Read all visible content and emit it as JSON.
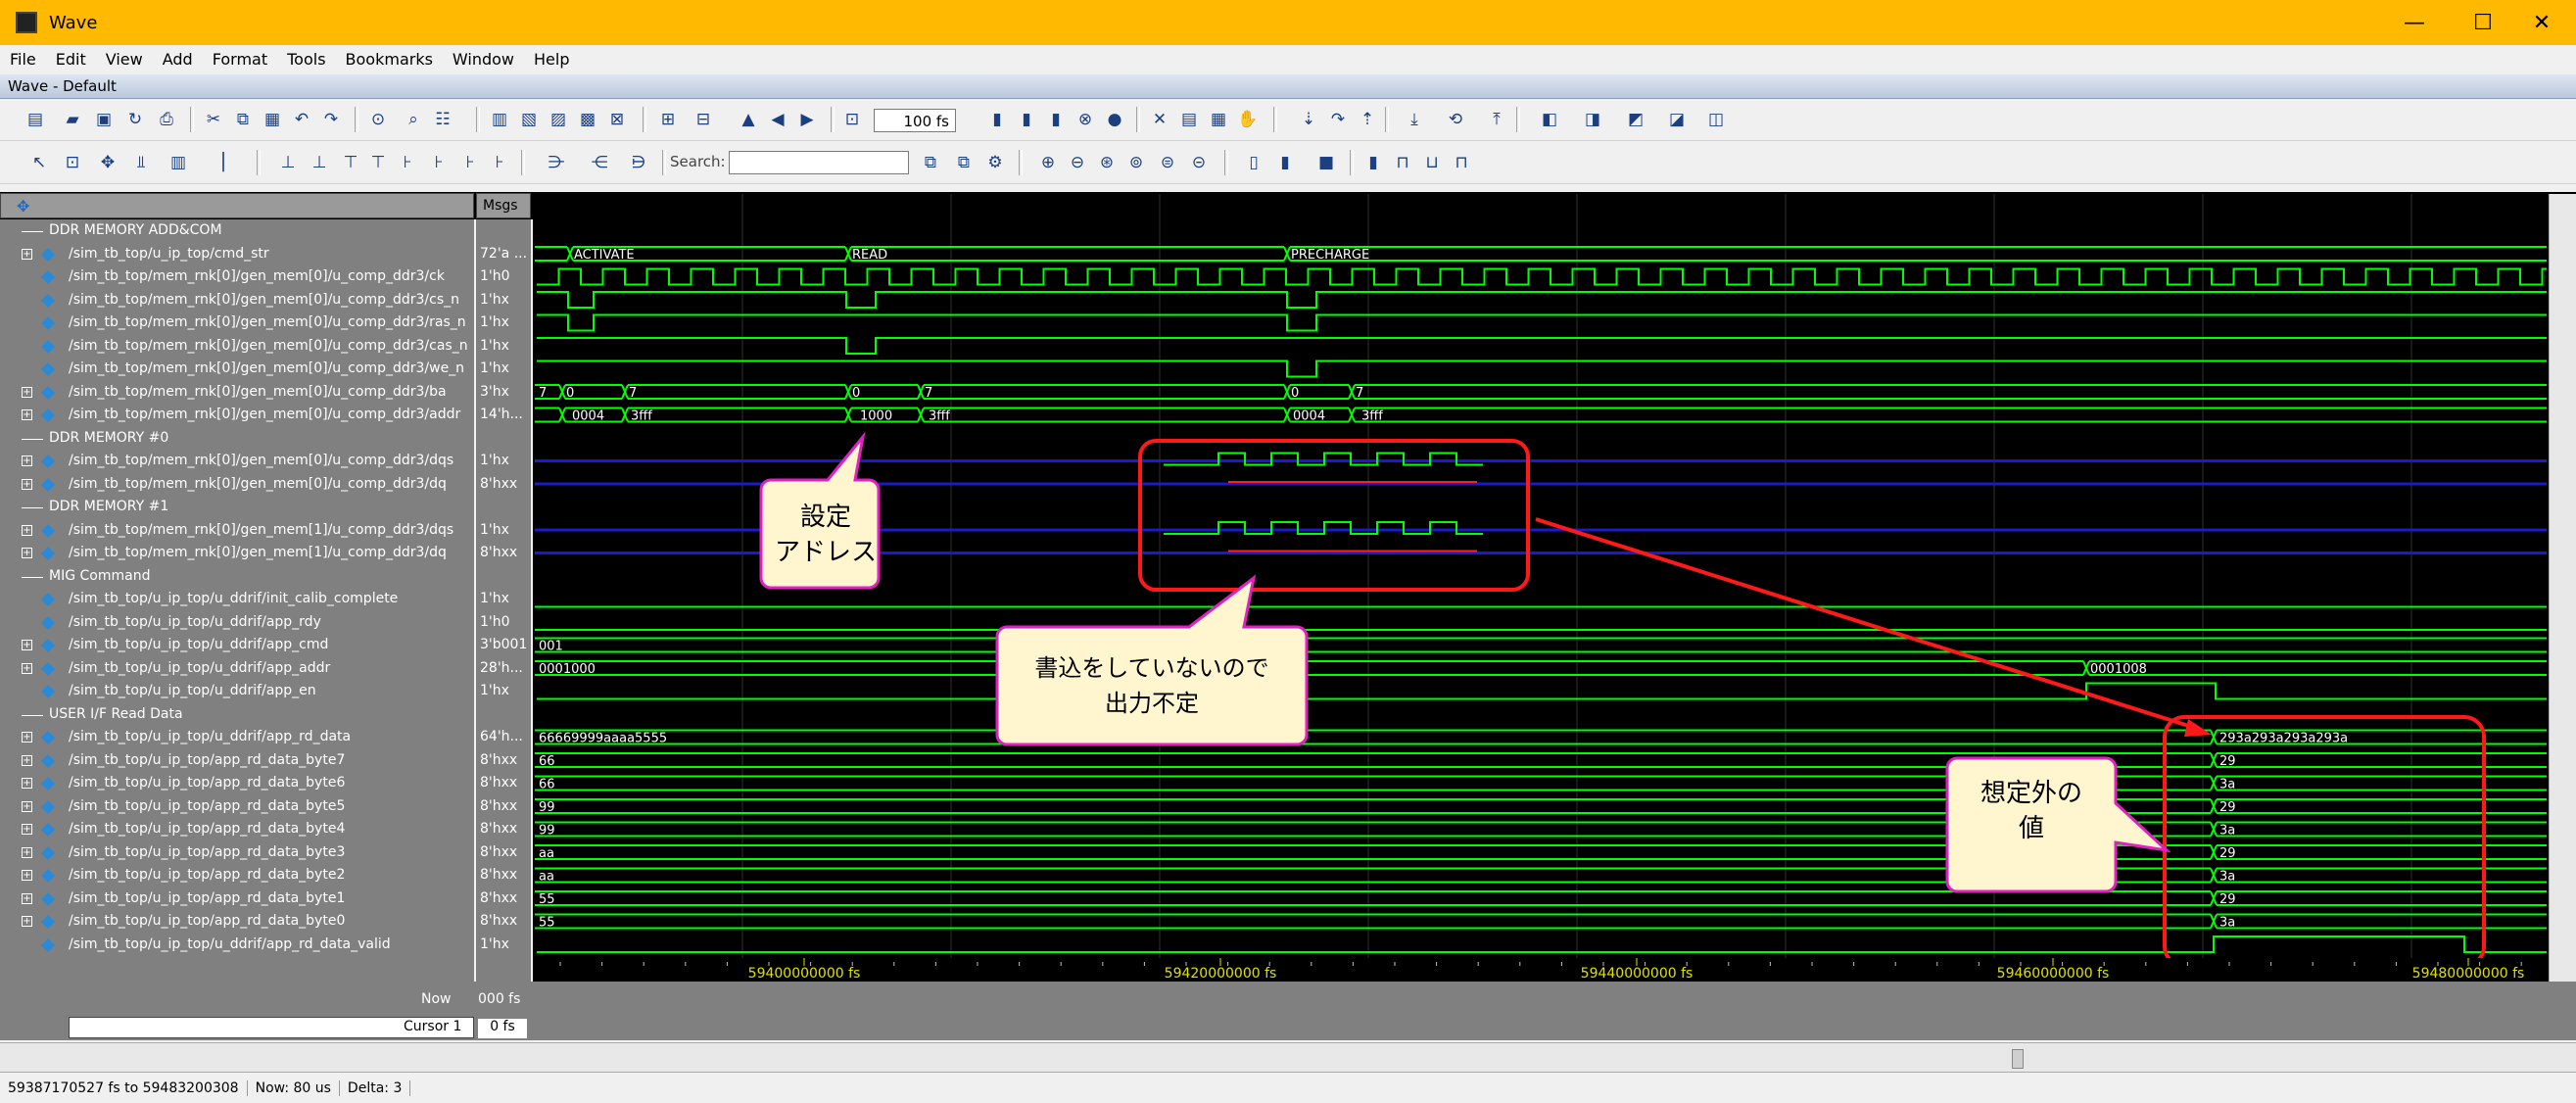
{
  "window": {
    "title": "Wave",
    "minimize": "—",
    "maximize": "☐",
    "close": "✕"
  },
  "menu": [
    "File",
    "Edit",
    "View",
    "Add",
    "Format",
    "Tools",
    "Bookmarks",
    "Window",
    "Help"
  ],
  "wave_header": "Wave - Default",
  "toolbar": {
    "zoom_value": "100 fs",
    "search_label": "Search:"
  },
  "panes": {
    "msgs_header": "Msgs"
  },
  "rows": [
    {
      "type": "divider",
      "label": "DDR MEMORY ADD&COM"
    },
    {
      "type": "signal",
      "expand": true,
      "label": "/sim_tb_top/u_ip_top/cmd_str",
      "msg": "72'a ..."
    },
    {
      "type": "signal",
      "expand": false,
      "label": "/sim_tb_top/mem_rnk[0]/gen_mem[0]/u_comp_ddr3/ck",
      "msg": "1'h0"
    },
    {
      "type": "signal",
      "expand": false,
      "label": "/sim_tb_top/mem_rnk[0]/gen_mem[0]/u_comp_ddr3/cs_n",
      "msg": "1'hx"
    },
    {
      "type": "signal",
      "expand": false,
      "label": "/sim_tb_top/mem_rnk[0]/gen_mem[0]/u_comp_ddr3/ras_n",
      "msg": "1'hx"
    },
    {
      "type": "signal",
      "expand": false,
      "label": "/sim_tb_top/mem_rnk[0]/gen_mem[0]/u_comp_ddr3/cas_n",
      "msg": "1'hx"
    },
    {
      "type": "signal",
      "expand": false,
      "label": "/sim_tb_top/mem_rnk[0]/gen_mem[0]/u_comp_ddr3/we_n",
      "msg": "1'hx"
    },
    {
      "type": "signal",
      "expand": true,
      "label": "/sim_tb_top/mem_rnk[0]/gen_mem[0]/u_comp_ddr3/ba",
      "msg": "3'hx"
    },
    {
      "type": "signal",
      "expand": true,
      "label": "/sim_tb_top/mem_rnk[0]/gen_mem[0]/u_comp_ddr3/addr",
      "msg": "14'h..."
    },
    {
      "type": "divider",
      "label": "DDR MEMORY #0"
    },
    {
      "type": "signal",
      "expand": true,
      "label": "/sim_tb_top/mem_rnk[0]/gen_mem[0]/u_comp_ddr3/dqs",
      "msg": "1'hx"
    },
    {
      "type": "signal",
      "expand": true,
      "label": "/sim_tb_top/mem_rnk[0]/gen_mem[0]/u_comp_ddr3/dq",
      "msg": "8'hxx"
    },
    {
      "type": "divider",
      "label": "DDR MEMORY #1"
    },
    {
      "type": "signal",
      "expand": true,
      "label": "/sim_tb_top/mem_rnk[0]/gen_mem[1]/u_comp_ddr3/dqs",
      "msg": "1'hx"
    },
    {
      "type": "signal",
      "expand": true,
      "label": "/sim_tb_top/mem_rnk[0]/gen_mem[1]/u_comp_ddr3/dq",
      "msg": "8'hxx"
    },
    {
      "type": "divider",
      "label": "MIG Command"
    },
    {
      "type": "signal",
      "expand": false,
      "label": "/sim_tb_top/u_ip_top/u_ddrif/init_calib_complete",
      "msg": "1'hx"
    },
    {
      "type": "signal",
      "expand": false,
      "label": "/sim_tb_top/u_ip_top/u_ddrif/app_rdy",
      "msg": "1'h0"
    },
    {
      "type": "signal",
      "expand": true,
      "label": "/sim_tb_top/u_ip_top/u_ddrif/app_cmd",
      "msg": "3'b001"
    },
    {
      "type": "signal",
      "expand": true,
      "label": "/sim_tb_top/u_ip_top/u_ddrif/app_addr",
      "msg": "28'h..."
    },
    {
      "type": "signal",
      "expand": false,
      "label": "/sim_tb_top/u_ip_top/u_ddrif/app_en",
      "msg": "1'hx"
    },
    {
      "type": "divider",
      "label": "USER I/F Read Data"
    },
    {
      "type": "signal",
      "expand": true,
      "label": "/sim_tb_top/u_ip_top/u_ddrif/app_rd_data",
      "msg": "64'h..."
    },
    {
      "type": "signal",
      "expand": true,
      "label": "/sim_tb_top/u_ip_top/app_rd_data_byte7",
      "msg": "8'hxx"
    },
    {
      "type": "signal",
      "expand": true,
      "label": "/sim_tb_top/u_ip_top/app_rd_data_byte6",
      "msg": "8'hxx"
    },
    {
      "type": "signal",
      "expand": true,
      "label": "/sim_tb_top/u_ip_top/app_rd_data_byte5",
      "msg": "8'hxx"
    },
    {
      "type": "signal",
      "expand": true,
      "label": "/sim_tb_top/u_ip_top/app_rd_data_byte4",
      "msg": "8'hxx"
    },
    {
      "type": "signal",
      "expand": true,
      "label": "/sim_tb_top/u_ip_top/app_rd_data_byte3",
      "msg": "8'hxx"
    },
    {
      "type": "signal",
      "expand": true,
      "label": "/sim_tb_top/u_ip_top/app_rd_data_byte2",
      "msg": "8'hxx"
    },
    {
      "type": "signal",
      "expand": true,
      "label": "/sim_tb_top/u_ip_top/app_rd_data_byte1",
      "msg": "8'hxx"
    },
    {
      "type": "signal",
      "expand": true,
      "label": "/sim_tb_top/u_ip_top/app_rd_data_byte0",
      "msg": "8'hxx"
    },
    {
      "type": "signal",
      "expand": false,
      "label": "/sim_tb_top/u_ip_top/u_ddrif/app_rd_data_valid",
      "msg": "1'hx"
    }
  ],
  "wave_labels": {
    "cmd_activate": "ACTIVATE",
    "cmd_read": "READ",
    "cmd_precharge": "PRECHARGE",
    "ba_a": "7",
    "ba_b": "0",
    "ba_c": "7",
    "ba_d": "0",
    "ba_e": "7",
    "ba_f": "0",
    "ba_g": "7",
    "addr_a": "0004",
    "addr_b": "3fff",
    "addr_c": "1000",
    "addr_d": "3fff",
    "addr_e": "0004",
    "addr_f": "3fff",
    "app_cmd": "001",
    "app_addr_a": "0001000",
    "app_addr_b": "0001008",
    "rd_data_a": "66669999aaaa5555",
    "rd_data_b": "293a293a293a293a",
    "b7a": "66",
    "b7b": "29",
    "b6a": "66",
    "b6b": "3a",
    "b5a": "99",
    "b5b": "29",
    "b4a": "99",
    "b4b": "3a",
    "b3a": "aa",
    "b3b": "29",
    "b2a": "aa",
    "b2b": "3a",
    "b1a": "55",
    "b1b": "29",
    "b0a": "55",
    "b0b": "3a"
  },
  "annotations": {
    "addr_note_l1": "設定",
    "addr_note_l2": "アドレス",
    "nowrite_note_l1": "書込をしていないので",
    "nowrite_note_l2": "出力不定",
    "unexpected_note_l1": "想定外の",
    "unexpected_note_l2": "値"
  },
  "time_axis": {
    "t1": "59400000000 fs",
    "t2": "59420000000 fs",
    "t3": "59440000000 fs",
    "t4": "59460000000 fs",
    "t5": "59480000000 fs"
  },
  "cursor": {
    "now_label": "Now",
    "now_value": "000 fs",
    "cursor_label": "Cursor 1",
    "cursor_value": "0 fs"
  },
  "status": {
    "range": "59387170527 fs to 59483200308",
    "now": "Now: 80 us",
    "delta": "Delta: 3"
  },
  "colors": {
    "wave": "#00ff00",
    "blue": "#1010a0",
    "highlight": "#ff1a1a",
    "note_fill": "#fff6d0",
    "note_border": "#e020c0",
    "titlebar": "#ffb900"
  }
}
